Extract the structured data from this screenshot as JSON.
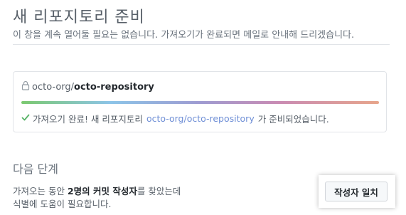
{
  "header": {
    "title": "새 리포지토리 준비",
    "subtitle": "이 창을 계속 열어둘 필요는 없습니다. 가져오기가 완료되면 메일로 안내해 드리겠습니다."
  },
  "import_card": {
    "repo_owner": "octo-org/",
    "repo_name": "octo-repository",
    "progress_fraction": 1.0,
    "status_prefix": "가져오기 완료! 새 리포지토리",
    "status_link": "octo-org/octo-repository",
    "status_suffix": "가 준비되었습니다.",
    "icons": [
      "lock-icon",
      "check-icon"
    ],
    "colors": {
      "check": "#56b366",
      "link": "#6f8fd6"
    }
  },
  "next_steps": {
    "heading": "다음 단계",
    "text_part1": "가져오는 동안 ",
    "text_bold1": "2명의 커밋 작성자",
    "text_part2": "를 찾았는데",
    "text_line2": "식별에 도움이 필요합니다.",
    "button_label": "작성자 일치"
  }
}
